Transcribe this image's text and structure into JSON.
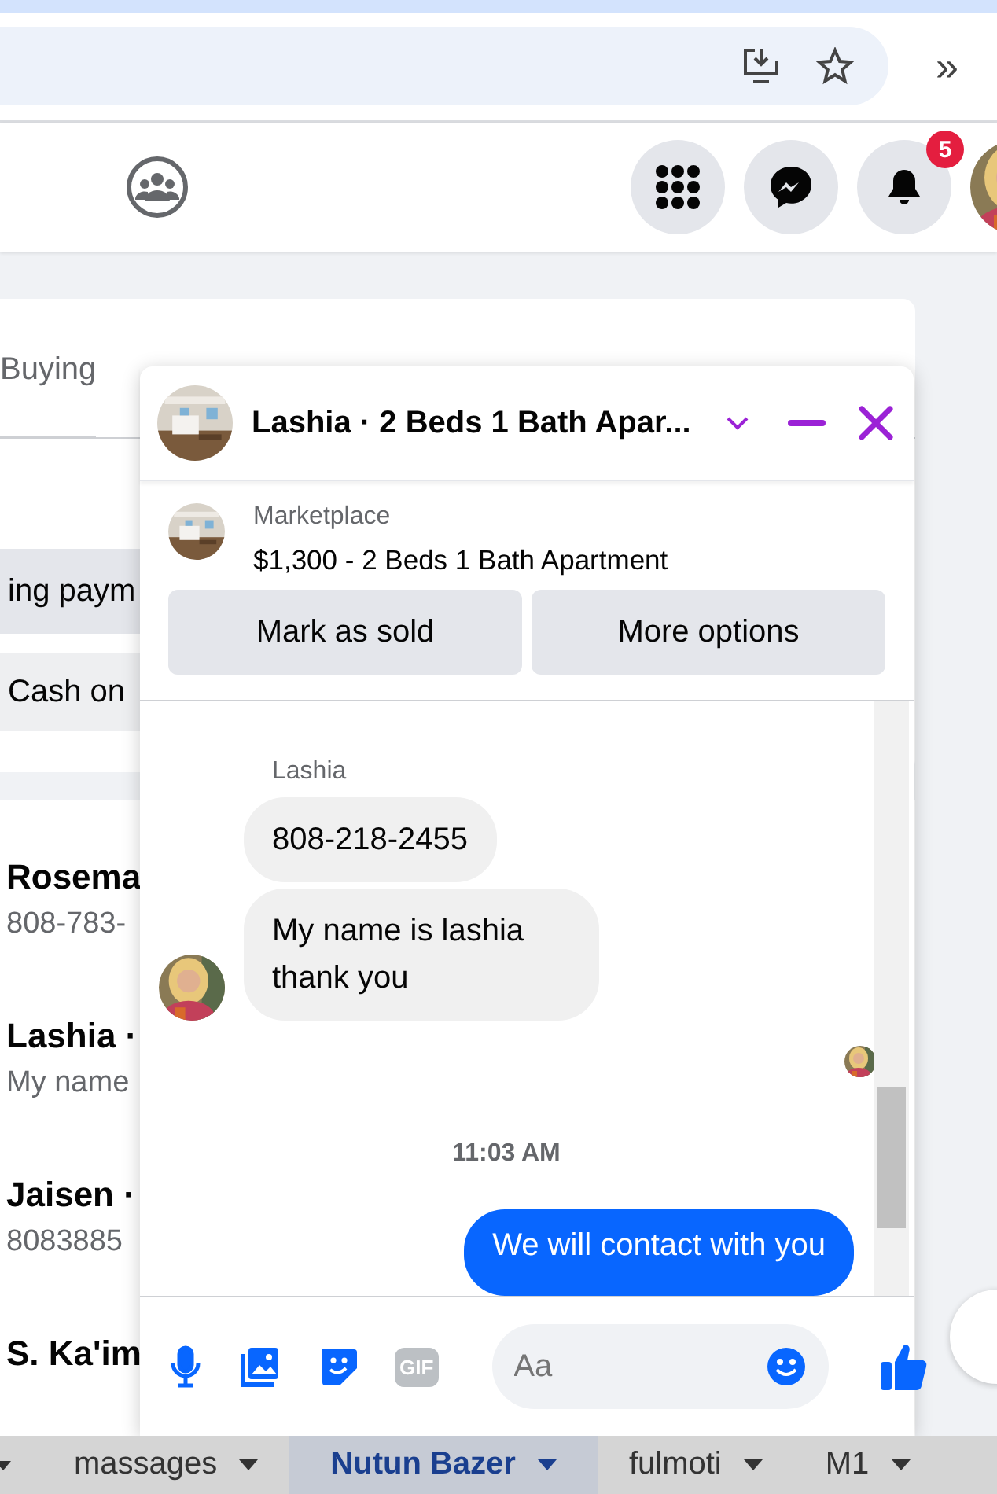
{
  "browser": {
    "overflow": "»"
  },
  "header": {
    "notification_count": "5"
  },
  "background": {
    "tab": "Buying",
    "chips": [
      "ing paym",
      "Cash on"
    ],
    "conversations": [
      {
        "name": "Rosema",
        "preview": "808-783-"
      },
      {
        "name": "Lashia ·",
        "preview": "My name"
      },
      {
        "name": "Jaisen ·",
        "preview": "8083885"
      },
      {
        "name": "S. Ka'im"
      }
    ]
  },
  "chat": {
    "title": "Lashia · 2 Beds 1 Bath Apar...",
    "listing": {
      "source": "Marketplace",
      "title": "$1,300 - 2 Beds 1 Bath Apartment"
    },
    "actions": [
      "Mark as sold",
      "More options"
    ],
    "messages": [
      {
        "kind": "sender",
        "text": "Lashia"
      },
      {
        "kind": "incoming",
        "text": "808-218-2455"
      },
      {
        "kind": "incoming",
        "text": "My name is lashia thank you"
      },
      {
        "kind": "seen"
      },
      {
        "kind": "time",
        "text": "11:03 AM"
      },
      {
        "kind": "outgoing",
        "text": "We will contact with you"
      }
    ],
    "composer": {
      "gif_label": "GIF",
      "placeholder": "Aa"
    }
  },
  "bookmarks": [
    {
      "label": "massages",
      "selected": false
    },
    {
      "label": "Nutun Bazer",
      "selected": true
    },
    {
      "label": "fulmoti",
      "selected": false
    },
    {
      "label": "M1",
      "selected": false
    }
  ]
}
